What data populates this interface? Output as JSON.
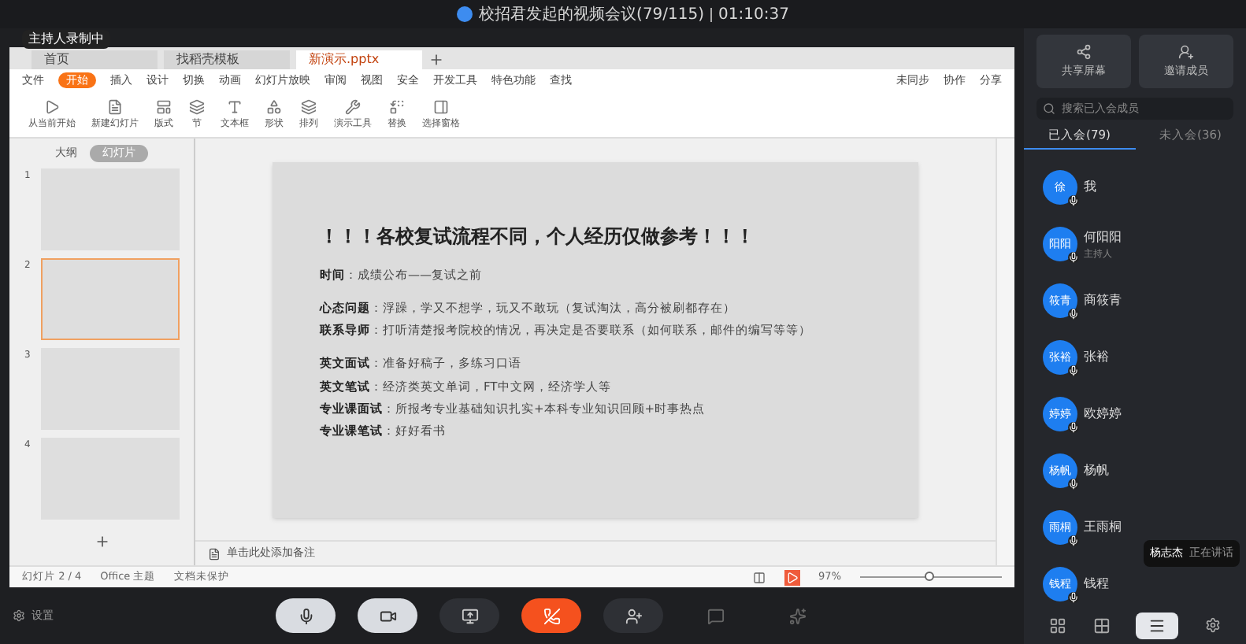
{
  "meeting": {
    "title": "校招君发起的视频会议(79/115)",
    "duration": "01:10:37",
    "recording_badge": "主持人录制中"
  },
  "wps": {
    "doc_tabs": [
      {
        "label": "首页",
        "selected": false
      },
      {
        "label": "找稻壳模板",
        "selected": false
      },
      {
        "label": "新演示.pptx",
        "selected": true
      }
    ],
    "menu": [
      {
        "label": "文件",
        "selected": false
      },
      {
        "label": "开始",
        "selected": true
      },
      {
        "label": "插入",
        "selected": false
      },
      {
        "label": "设计",
        "selected": false
      },
      {
        "label": "切换",
        "selected": false
      },
      {
        "label": "动画",
        "selected": false
      },
      {
        "label": "幻灯片放映",
        "selected": false
      },
      {
        "label": "审阅",
        "selected": false
      },
      {
        "label": "视图",
        "selected": false
      },
      {
        "label": "安全",
        "selected": false
      },
      {
        "label": "开发工具",
        "selected": false
      },
      {
        "label": "特色功能",
        "selected": false
      },
      {
        "label": "查找",
        "selected": false
      }
    ],
    "menu_right": [
      "未同步",
      "协作",
      "分享"
    ],
    "ribbon": [
      "从当前开始",
      "新建幻灯片",
      "版式",
      "节",
      "文本框",
      "形状",
      "排列",
      "演示工具",
      "替换",
      "选择窗格"
    ],
    "pane_tabs": [
      {
        "label": "大纲",
        "selected": false
      },
      {
        "label": "幻灯片",
        "selected": true
      }
    ],
    "thumbnails": [
      {
        "number": "1",
        "selected": false
      },
      {
        "number": "2",
        "selected": true
      },
      {
        "number": "3",
        "selected": false
      },
      {
        "number": "4",
        "selected": false
      }
    ],
    "slide": {
      "title": "！！！各校复试流程不同，个人经历仅做参考！！！",
      "groups": [
        [
          {
            "label": "时间",
            "text": "：成绩公布——复试之前"
          }
        ],
        [
          {
            "label": "心态问题",
            "text": "：浮躁，学又不想学，玩又不敢玩（复试淘汰，高分被刷都存在）"
          },
          {
            "label": "联系导师",
            "text": "：打听清楚报考院校的情况，再决定是否要联系（如何联系，邮件的编写等等）"
          }
        ],
        [
          {
            "label": "英文面试",
            "text": "：准备好稿子，多练习口语"
          },
          {
            "label": "英文笔试",
            "text": "：经济类英文单词，FT中文网，经济学人等"
          },
          {
            "label": "专业课面试",
            "text": "：所报考专业基础知识扎实+本科专业知识回顾+时事热点"
          },
          {
            "label": "专业课笔试",
            "text": "：好好看书"
          }
        ]
      ]
    },
    "notes_placeholder": "单击此处添加备注",
    "status": {
      "slide": "幻灯片 2 / 4",
      "theme": "Office 主题",
      "protection": "文档未保护",
      "zoom": "97%",
      "level": 0.45
    }
  },
  "panel": {
    "actions": [
      "共享屏幕",
      "邀请成员"
    ],
    "search": {
      "placeholder": "搜索已入会成员"
    },
    "tabs": [
      {
        "label": "已入会(79)",
        "selected": true
      },
      {
        "label": "未入会(36)",
        "selected": false
      }
    ],
    "members": [
      {
        "avatar": "徐",
        "name": "我"
      },
      {
        "avatar": "阳阳",
        "name": "何阳阳",
        "role": "主持人"
      },
      {
        "avatar": "筱青",
        "name": "商筱青"
      },
      {
        "avatar": "张裕",
        "name": "张裕"
      },
      {
        "avatar": "婷婷",
        "name": "欧婷婷"
      },
      {
        "avatar": "杨帆",
        "name": "杨帆"
      },
      {
        "avatar": "雨桐",
        "name": "王雨桐"
      },
      {
        "avatar": "钱程",
        "name": "钱程"
      }
    ],
    "speaking": {
      "name": "杨志杰",
      "text": "正在讲话"
    }
  },
  "footer": {
    "settings": "设置"
  }
}
